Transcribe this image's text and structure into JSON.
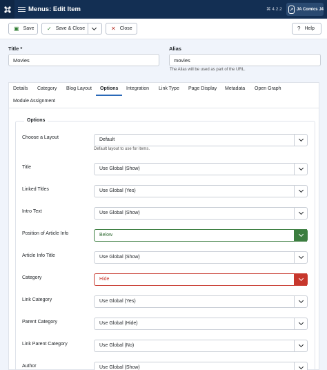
{
  "header": {
    "title": "Menus: Edit Item",
    "version": "⌘ 4.2.2",
    "site_label": "JA Comics J4"
  },
  "toolbar": {
    "save": "Save",
    "save_close": "Save & Close",
    "close": "Close",
    "help": "Help"
  },
  "form": {
    "title_label": "Title *",
    "title_value": "Movies",
    "alias_label": "Alias",
    "alias_value": "movies",
    "alias_help": "The Alias will be used as part of the URL."
  },
  "tabs": [
    "Details",
    "Category",
    "Blog Layout",
    "Options",
    "Integration",
    "Link Type",
    "Page Display",
    "Metadata",
    "Open Graph",
    "Module Assignment"
  ],
  "active_tab": "Options",
  "options": {
    "legend": "Options",
    "layout_help": "Default layout to use for items.",
    "rows": [
      {
        "label": "Choose a Layout",
        "value": "Default",
        "state": "normal"
      },
      {
        "label": "Title",
        "value": "Use Global (Show)",
        "state": "normal"
      },
      {
        "label": "Linked Titles",
        "value": "Use Global (Yes)",
        "state": "normal"
      },
      {
        "label": "Intro Text",
        "value": "Use Global (Show)",
        "state": "normal"
      },
      {
        "label": "Position of Article Info",
        "value": "Below",
        "state": "green"
      },
      {
        "label": "Article Info Title",
        "value": "Use Global (Show)",
        "state": "normal"
      },
      {
        "label": "Category",
        "value": "Hide",
        "state": "red"
      },
      {
        "label": "Link Category",
        "value": "Use Global (Yes)",
        "state": "normal"
      },
      {
        "label": "Parent Category",
        "value": "Use Global (Hide)",
        "state": "normal"
      },
      {
        "label": "Link Parent Category",
        "value": "Use Global (No)",
        "state": "normal"
      },
      {
        "label": "Author",
        "value": "Use Global (Show)",
        "state": "normal"
      }
    ]
  },
  "colors": {
    "header_bg": "#132f53",
    "active_tab": "#2a69b8",
    "green": "#3b7d3f",
    "red": "#c7372c"
  }
}
